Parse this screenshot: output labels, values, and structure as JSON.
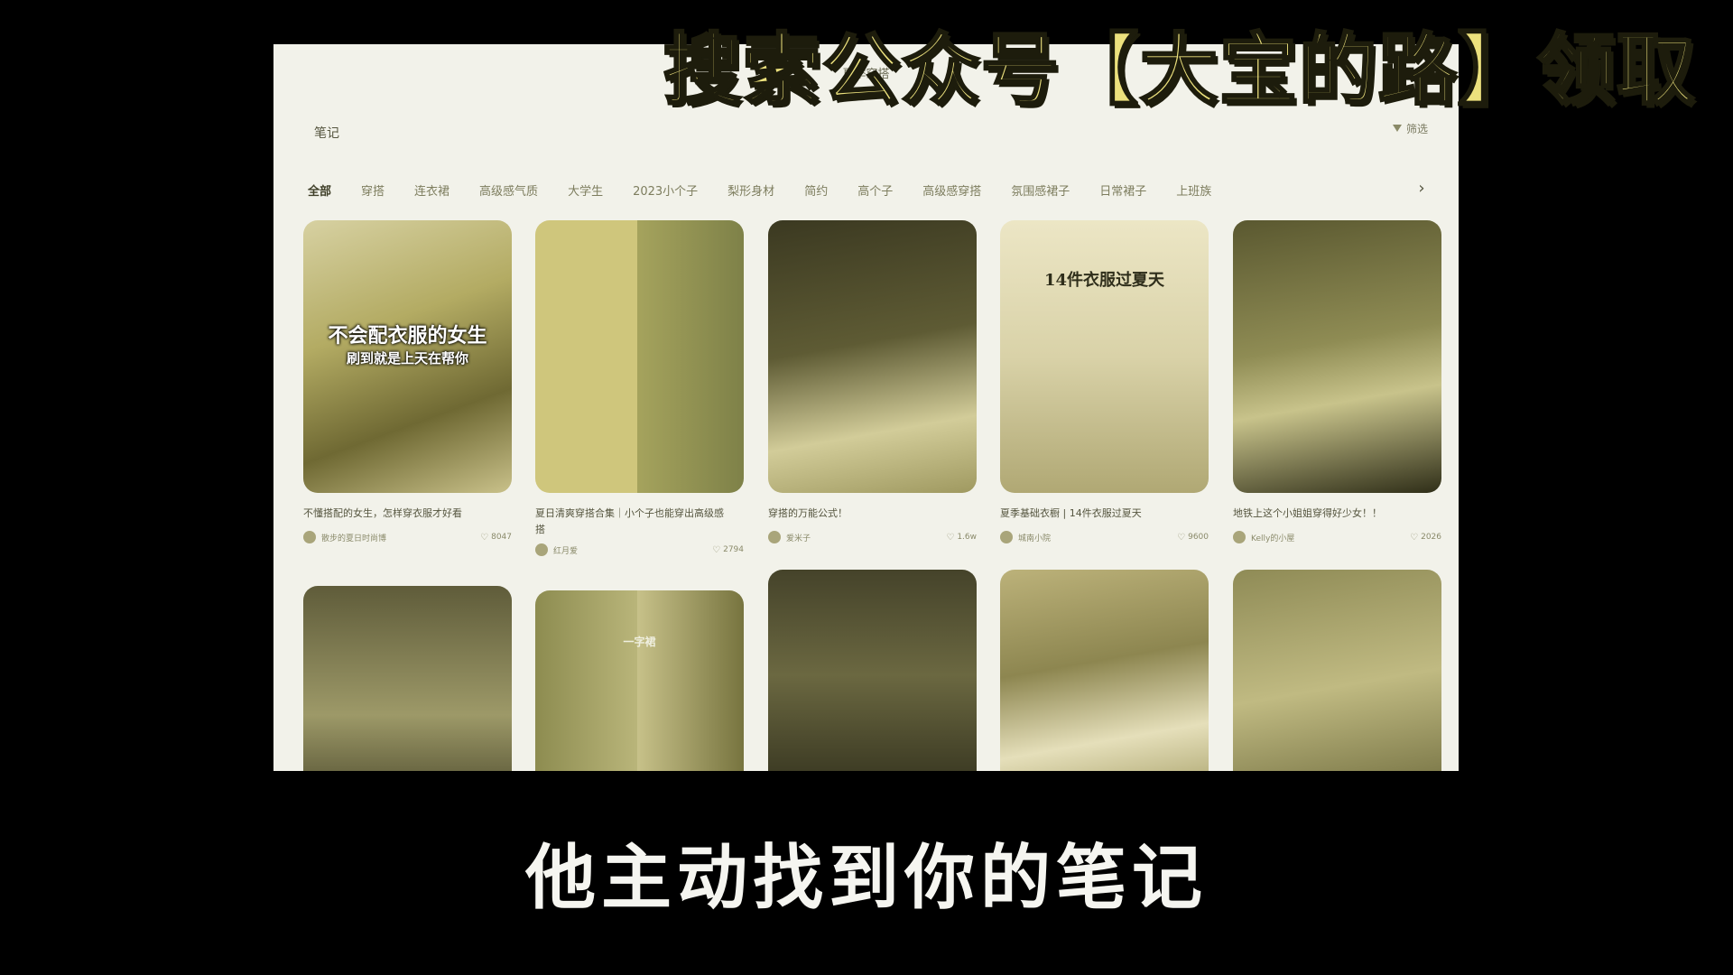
{
  "banner": {
    "text": "搜索公众号【大宝的路】领取"
  },
  "subtitle": {
    "text": "他主动找到你的笔记"
  },
  "app": {
    "search_title": "夏季穿搭",
    "page_title": "笔记",
    "filter_label": "筛选",
    "tabs": [
      "全部",
      "穿搭",
      "连衣裙",
      "高级感气质",
      "大学生",
      "2023小个子",
      "梨形身材",
      "简约",
      "高个子",
      "高级感穿搭",
      "氛围感裙子",
      "日常裙子",
      "上班族"
    ],
    "tab_next_icon": "chevron-right-icon"
  },
  "cards": [
    {
      "title": "不懂搭配的女生，怎样穿衣服才好看",
      "overlay1": "不会配衣服的女生",
      "overlay2": "刷到就是上天在帮你",
      "author": "散步的夏日时尚博",
      "likes": "8047"
    },
    {
      "title": "夏日清爽穿搭合集｜小个子也能穿出高级感",
      "title2": "搭",
      "author": "红月爱",
      "likes": "2794"
    },
    {
      "title": "穿搭的万能公式！",
      "author": "爱米子",
      "likes": "1.6w"
    },
    {
      "title": "夏季基础衣橱 | 14件衣服过夏天",
      "overlay1": "14件衣服过夏天",
      "author": "城南小院",
      "likes": "9600"
    },
    {
      "title": "地铁上这个小姐姐穿得好少女！！",
      "author": "Kelly的小屋",
      "likes": "2026"
    },
    {
      "title": ""
    },
    {
      "title": "",
      "overlay1": "一字裙"
    },
    {
      "title": ""
    },
    {
      "title": ""
    },
    {
      "title": ""
    }
  ]
}
